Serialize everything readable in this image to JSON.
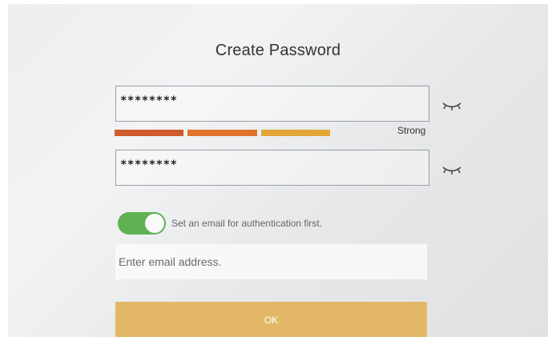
{
  "dialog": {
    "title": "Create Password"
  },
  "password": {
    "value": "********",
    "visibility_icon": "eye-closed-icon"
  },
  "strength": {
    "label": "Strong",
    "level_fraction": 0.75,
    "segment_colors": [
      "#cf5a2c",
      "#e0742c",
      "#e3a536"
    ]
  },
  "confirm_password": {
    "value": "********",
    "visibility_icon": "eye-closed-icon"
  },
  "email_auth": {
    "toggle_on": true,
    "toggle_color": "#5fb152",
    "label": "Set an email for authentication first.",
    "placeholder": "Enter email address."
  },
  "ok_button": {
    "label": "OK",
    "color": "#e2b866"
  }
}
